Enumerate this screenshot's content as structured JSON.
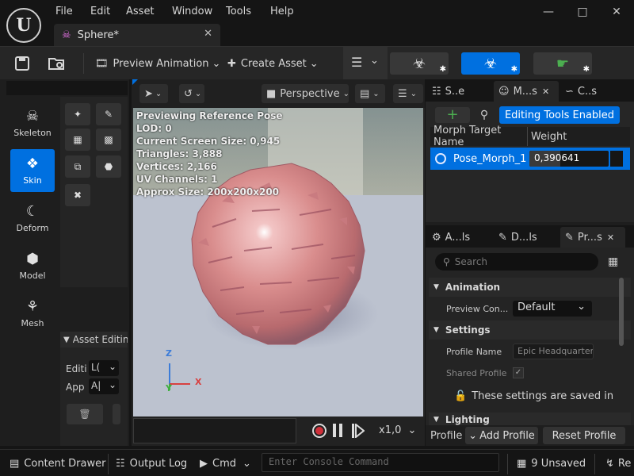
{
  "menu": [
    "File",
    "Edit",
    "Asset",
    "Window",
    "Tools",
    "Help"
  ],
  "document_tab": {
    "label": "Sphere*"
  },
  "toolbar": {
    "preview_animation": "Preview Animation",
    "create_asset": "Create Asset"
  },
  "modes": [
    {
      "label": "Skeleton",
      "icon": "skeleton-icon"
    },
    {
      "label": "Skin",
      "icon": "skin-icon"
    },
    {
      "label": "Deform",
      "icon": "deform-icon"
    },
    {
      "label": "Model",
      "icon": "model-icon"
    },
    {
      "label": "Mesh",
      "icon": "mesh-icon"
    }
  ],
  "asset_editing": {
    "title": "Asset Editin",
    "edit_label": "Editi",
    "edit_value": "L(",
    "apply_label": "App",
    "apply_value": "A|"
  },
  "viewport": {
    "perspective": "Perspective",
    "stats": [
      "Previewing Reference Pose",
      "LOD: 0",
      "Current Screen Size: 0,945",
      "Triangles: 3,888",
      "Vertices: 2,166",
      "UV Channels: 1",
      "Approx Size: 200x200x200"
    ],
    "axis_z": "Z",
    "axis_y": "Y",
    "axis_x": "X",
    "playback_speed": "x1,0"
  },
  "morph_panel": {
    "tabs": [
      "S..e",
      "M...s",
      "C..s"
    ],
    "editing_tools": "Editing Tools Enabled",
    "col_name": "Morph Target Name",
    "col_weight": "Weight",
    "row_name": "Pose_Morph_1",
    "row_weight": "0,390641",
    "row_weight_fraction": 0.39
  },
  "details_panel": {
    "tabs": [
      "A...ls",
      "D...ls",
      "Pr...s"
    ],
    "search_placeholder": "Search",
    "animation_header": "Animation",
    "preview_con_label": "Preview Con...",
    "preview_con_value": "Default",
    "settings_header": "Settings",
    "profile_name_label": "Profile Name",
    "profile_name_value": "Epic Headquarter",
    "shared_profile_label": "Shared Profile",
    "saved_note": "These settings are saved in",
    "lighting_header": "Lighting",
    "profile_label": "Profile",
    "add_profile": "Add Profile",
    "reset_profile": "Reset Profile"
  },
  "statusbar": {
    "content_drawer": "Content Drawer",
    "output_log": "Output Log",
    "cmd": "Cmd",
    "console_placeholder": "Enter Console Command",
    "unsaved": "9 Unsaved",
    "revision": "Re"
  },
  "colors": {
    "accent": "#0070e0",
    "record": "#d0303a",
    "add_green": "#4caf50"
  }
}
